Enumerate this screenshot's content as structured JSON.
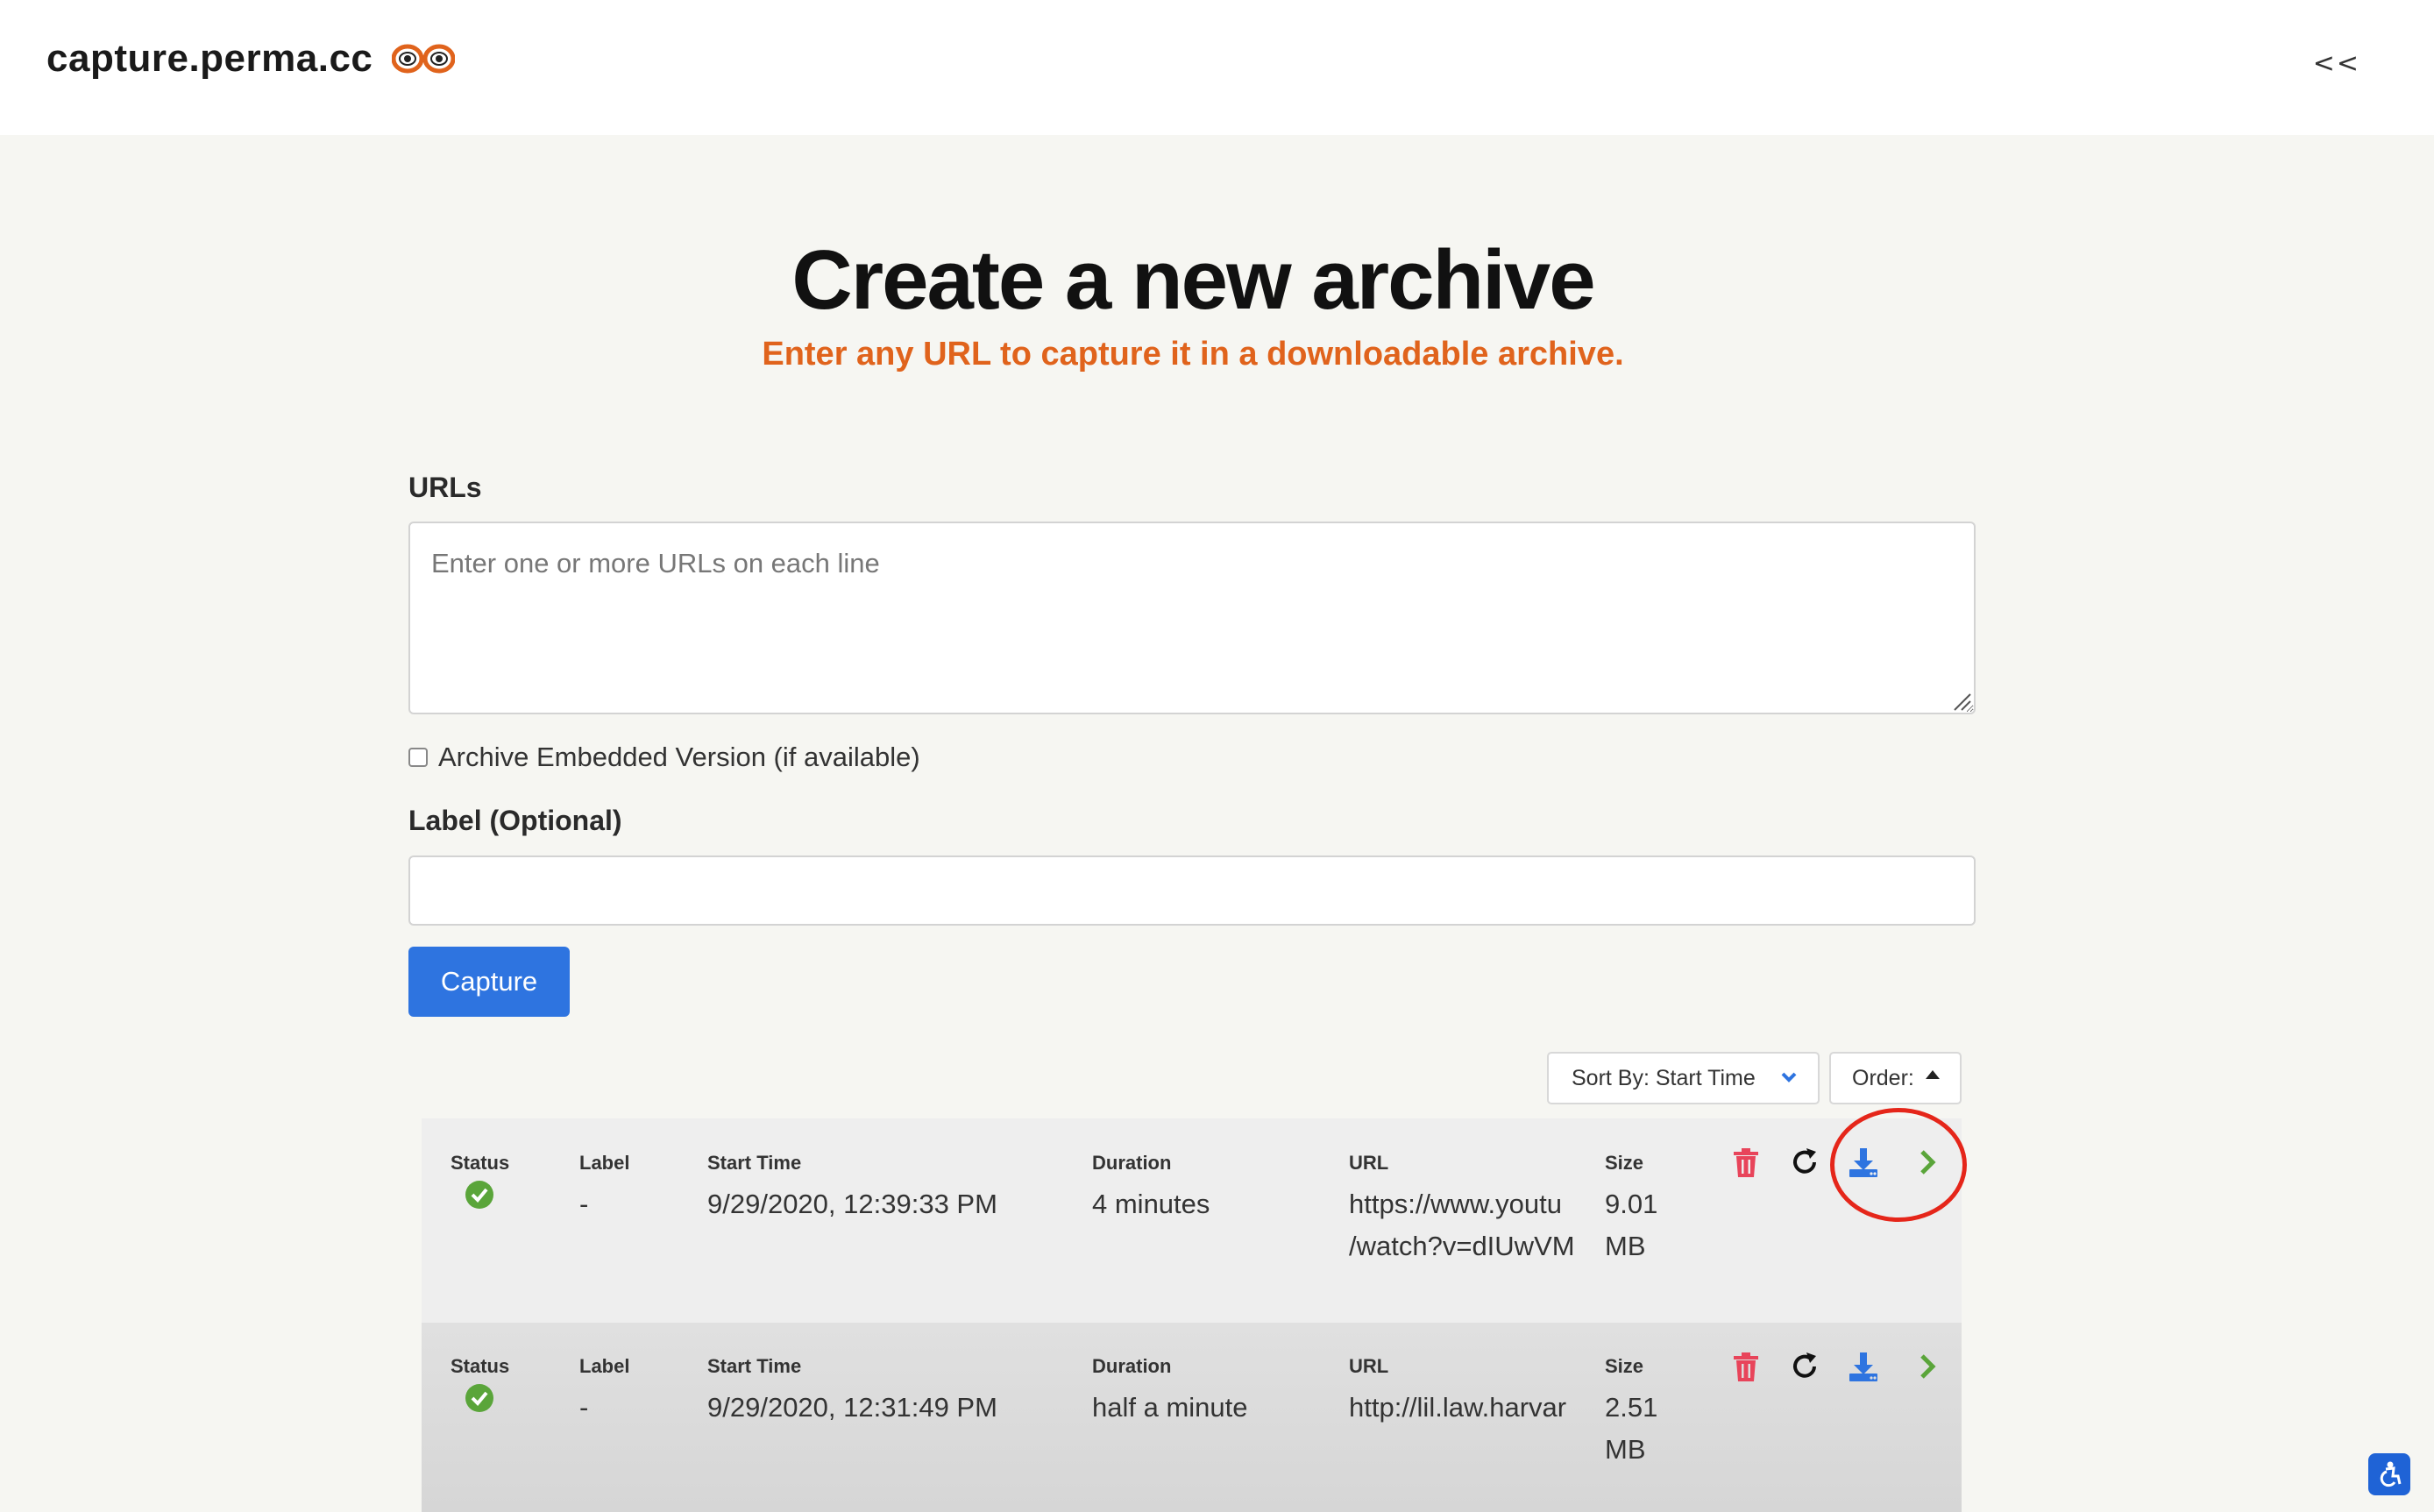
{
  "header": {
    "brand": "capture.perma.cc",
    "collapse_label": "<<"
  },
  "hero": {
    "title": "Create a new archive",
    "subtitle": "Enter any URL to capture it in a downloadable archive."
  },
  "form": {
    "urls_label": "URLs",
    "urls_placeholder": "Enter one or more URLs on each line",
    "embed_checkbox_label": "Archive Embedded Version (if available)",
    "embed_checked": false,
    "label_label": "Label (Optional)",
    "label_value": "",
    "capture_button": "Capture"
  },
  "sort": {
    "sort_by": "Sort By: Start Time",
    "order": "Order:"
  },
  "columns": {
    "status": "Status",
    "label": "Label",
    "start_time": "Start Time",
    "duration": "Duration",
    "url": "URL",
    "size": "Size"
  },
  "rows": [
    {
      "status": "success",
      "label": "-",
      "start_time": "9/29/2020, 12:39:33 PM",
      "duration": "4 minutes",
      "url_line1": "https://www.youtu",
      "url_line2": "/watch?v=dIUwVM",
      "size_line1": "9.01",
      "size_line2": "MB"
    },
    {
      "status": "success",
      "label": "-",
      "start_time": "9/29/2020, 12:31:49 PM",
      "duration": "half a minute",
      "url_line1": "http://lil.law.harvar",
      "url_line2": "",
      "size_line1": "2.51",
      "size_line2": "MB"
    }
  ],
  "icons": {
    "delete": "trash-icon",
    "retry": "refresh-icon",
    "download": "download-icon",
    "open": "chevron-right-icon",
    "status_ok": "check-circle-icon",
    "accessibility": "accessibility-icon"
  },
  "colors": {
    "accent_blue": "#2e74e0",
    "subtitle_orange": "#e0631c",
    "delete_red": "#e8445a",
    "success_green": "#5aa53a",
    "highlight_red": "#e5261a"
  }
}
